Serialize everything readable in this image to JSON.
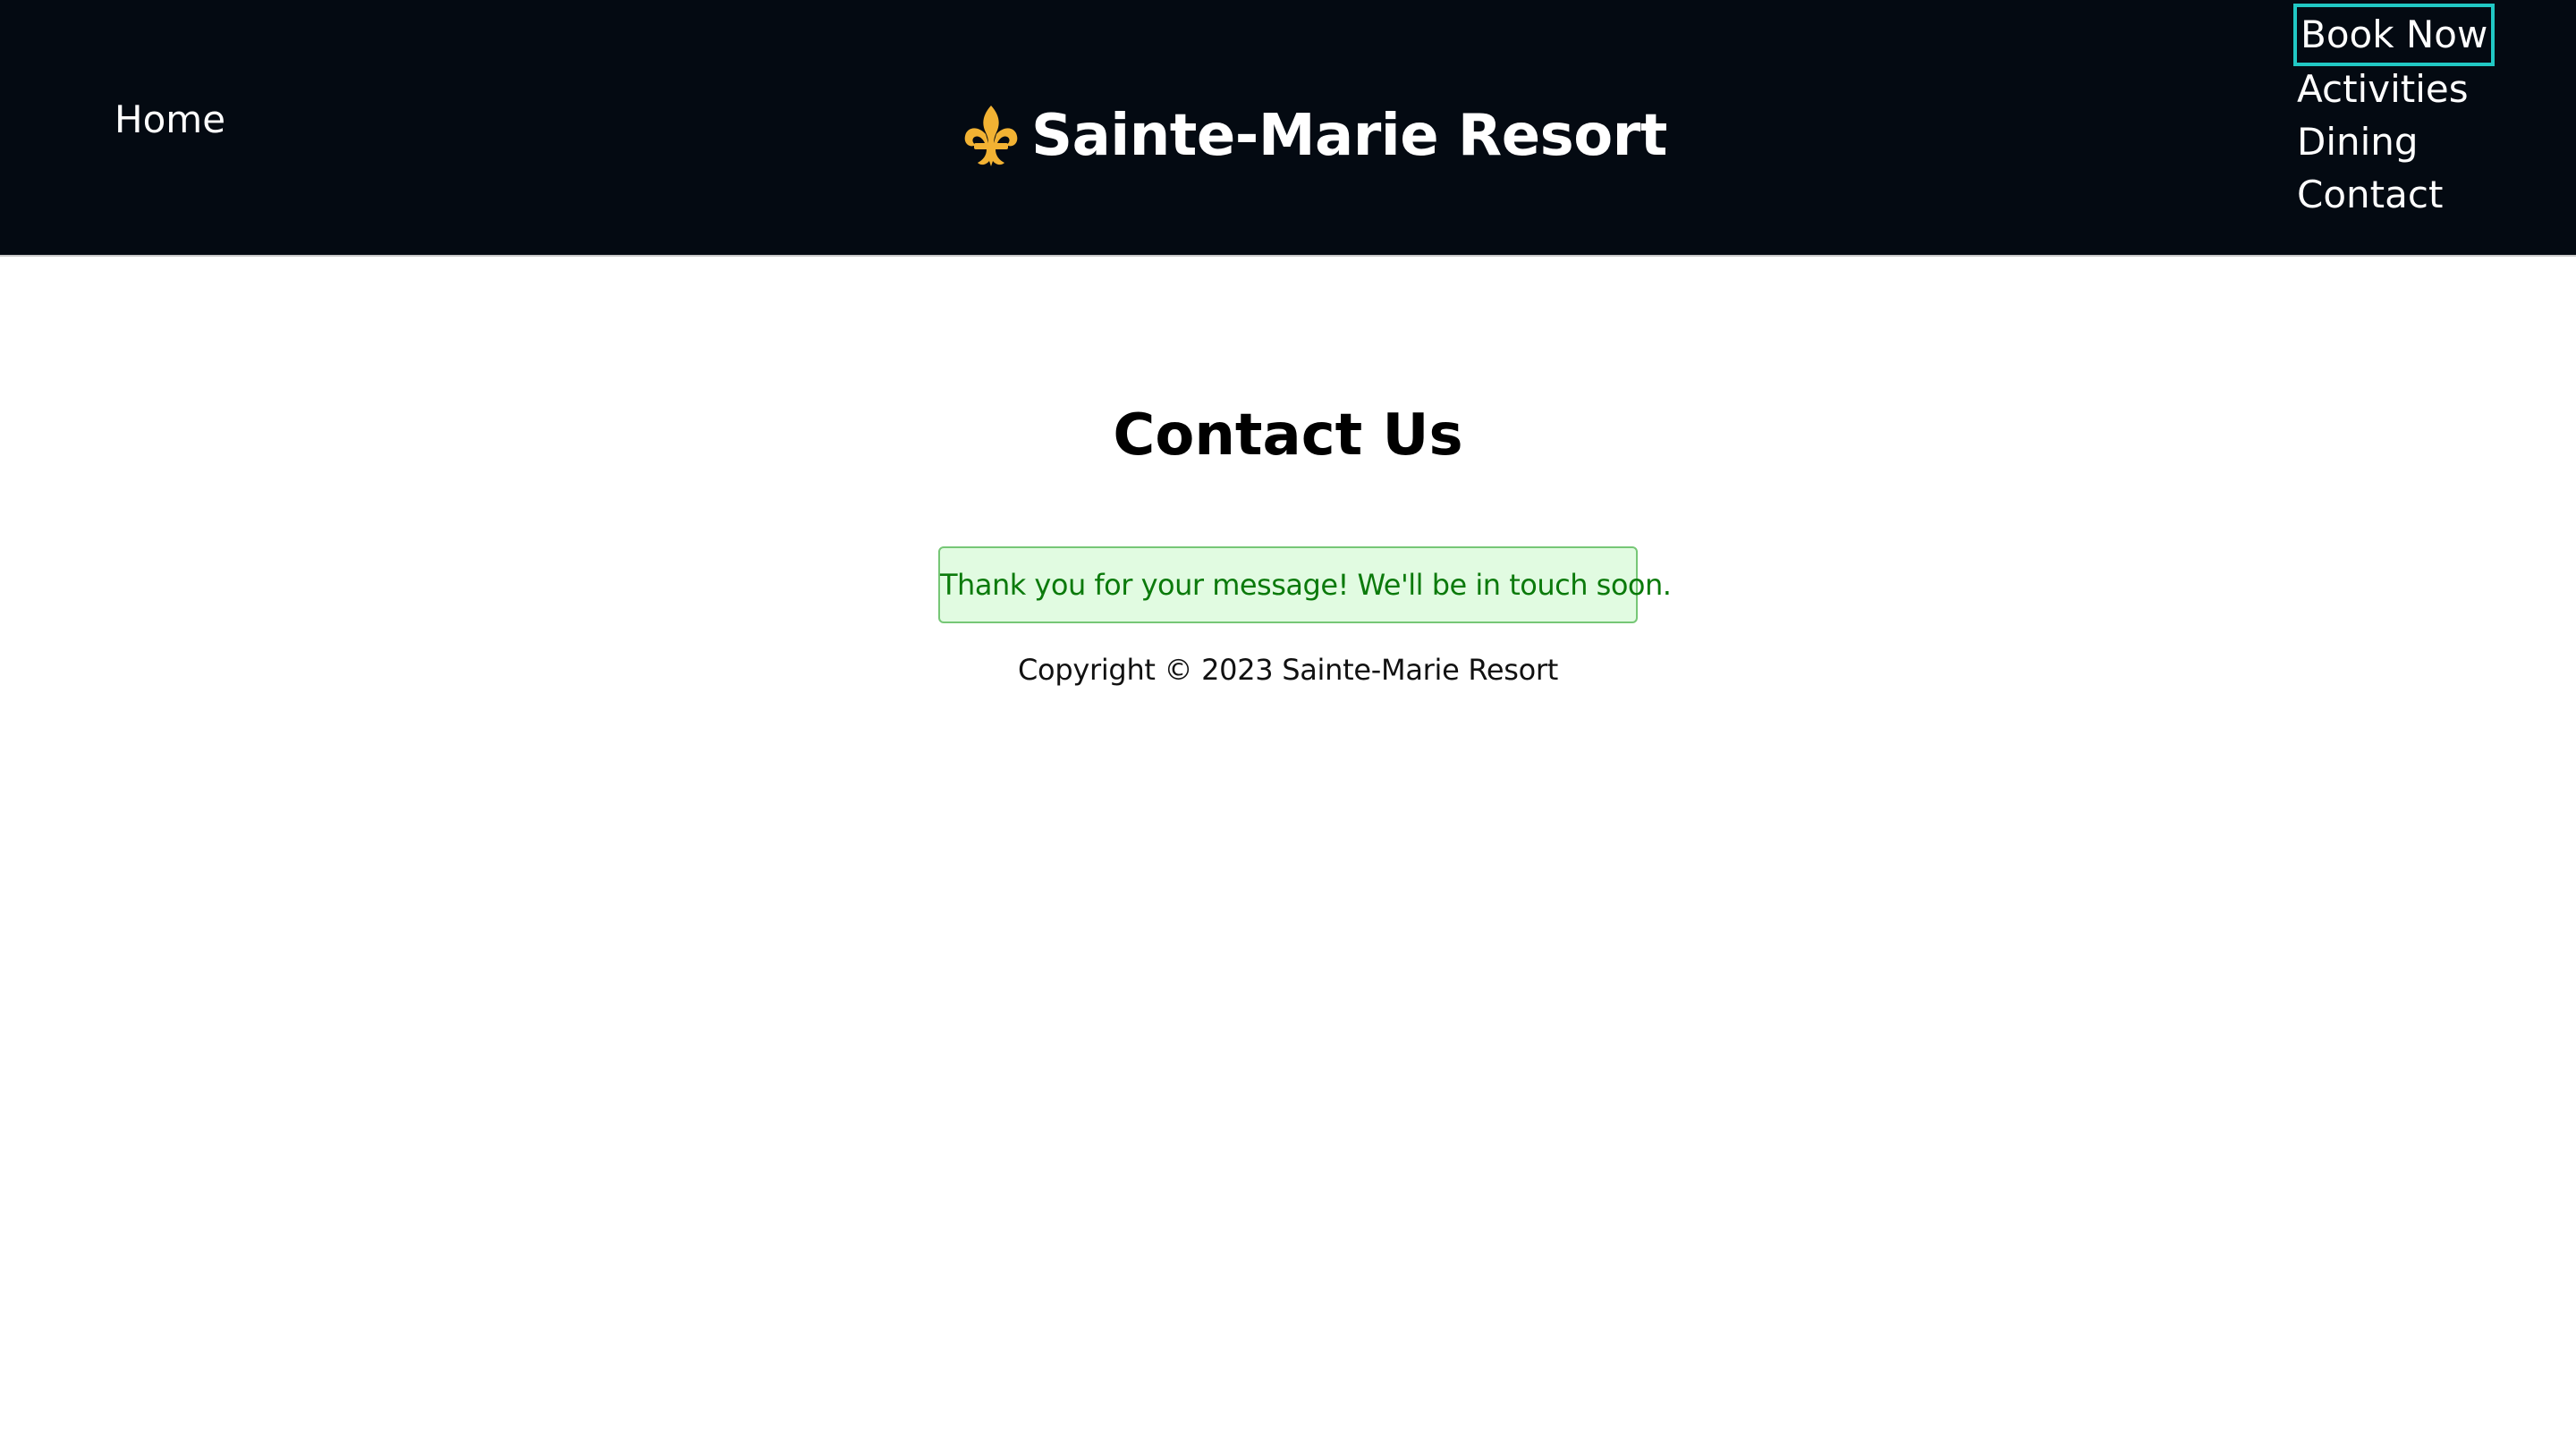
{
  "header": {
    "home_label": "Home",
    "brand": {
      "icon": "fleur-de-lis-icon",
      "icon_color": "#f2b233",
      "title": "Sainte-Marie Resort"
    },
    "nav_links": [
      {
        "label": "Book Now",
        "focused": true
      },
      {
        "label": "Activities"
      },
      {
        "label": "Dining"
      },
      {
        "label": "Contact"
      }
    ]
  },
  "main": {
    "title": "Contact Us",
    "success_message": "Thank you for your message! We'll be in touch soon.",
    "footer_text": "Copyright © 2023 Sainte-Marie Resort"
  },
  "colors": {
    "header_bg": "#040a12",
    "focus_outline": "#21c8c4",
    "success_bg": "#e1fbe1",
    "success_border": "#76c776",
    "success_text": "#0b7a0b"
  }
}
